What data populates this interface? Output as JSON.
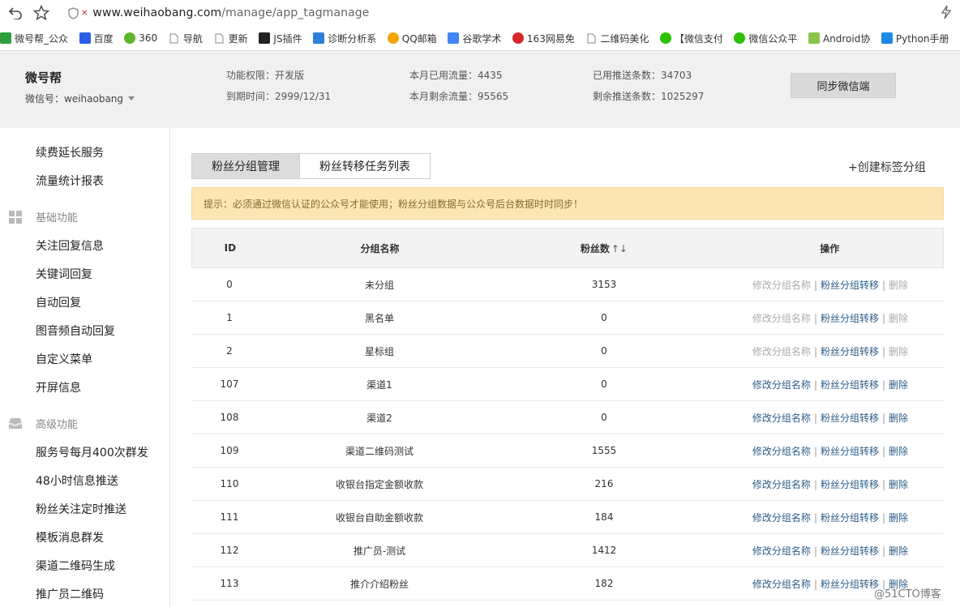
{
  "browser": {
    "url_host": "www.weihaobang.com",
    "url_path": "/manage/app_tagmanage"
  },
  "bookmarks": [
    {
      "label": "微号帮_公众",
      "icon": "weihaobang-icon",
      "color": "#2e9e3e"
    },
    {
      "label": "百度",
      "icon": "baidu-paw-icon",
      "color": "#2b5ce6"
    },
    {
      "label": "360",
      "icon": "360-icon",
      "color": "#5fb52b"
    },
    {
      "label": "导航",
      "icon": "page-icon",
      "color": "#ffffff"
    },
    {
      "label": "更新",
      "icon": "page-icon",
      "color": "#ffffff"
    },
    {
      "label": "JS插件",
      "icon": "js-icon",
      "color": "#222222"
    },
    {
      "label": "诊断分析系",
      "icon": "diagnose-icon",
      "color": "#2f7ed8"
    },
    {
      "label": "QQ邮箱",
      "icon": "qqmail-icon",
      "color": "#f2a400"
    },
    {
      "label": "谷歌学术",
      "icon": "google-icon",
      "color": "#4285f4"
    },
    {
      "label": "163网易免",
      "icon": "netease-icon",
      "color": "#d8272d"
    },
    {
      "label": "二维码美化",
      "icon": "page-icon",
      "color": "#ffffff"
    },
    {
      "label": "【微信支付",
      "icon": "wechat-icon",
      "color": "#2dc100"
    },
    {
      "label": "微信公众平",
      "icon": "wechat-icon",
      "color": "#2dc100"
    },
    {
      "label": "Android协",
      "icon": "android-icon",
      "color": "#8bc34a"
    },
    {
      "label": "Python手册",
      "icon": "python-icon",
      "color": "#1e88e5"
    }
  ],
  "account": {
    "name": "微号帮",
    "wechat_id": "微信号：weihaobang",
    "permission": "功能权限：开发版",
    "expire": "到期时间：2999/12/31",
    "used_traffic": "本月已用流量：4435",
    "remaining_traffic": "本月剩余流量：95565",
    "pushed": "已用推送条数：34703",
    "remaining_push": "剩余推送条数：1025297",
    "sync_button": "同步微信端"
  },
  "sidebar": {
    "top_items": [
      "续费延长服务",
      "流量统计报表"
    ],
    "basic_header": "基础功能",
    "basic_items": [
      "关注回复信息",
      "关键词回复",
      "自动回复",
      "图音频自动回复",
      "自定义菜单",
      "开屏信息"
    ],
    "advanced_header": "高级功能",
    "advanced_items": [
      "服务号每月400次群发",
      "48小时信息推送",
      "粉丝关注定时推送",
      "模板消息群发",
      "渠道二维码生成",
      "推广员二维码"
    ]
  },
  "main": {
    "tabs": [
      "粉丝分组管理",
      "粉丝转移任务列表"
    ],
    "create_link": "+创建标签分组",
    "notice": "提示：必须通过微信认证的公众号才能使用；粉丝分组数据与公众号后台数据时时同步！",
    "columns": {
      "id": "ID",
      "name": "分组名称",
      "fans": "粉丝数",
      "sort": "↑↓",
      "op": "操作"
    },
    "ops": {
      "edit": "修改分组名称",
      "transfer": "粉丝分组转移",
      "delete": "删除",
      "sep": "|"
    },
    "rows": [
      {
        "id": "0",
        "name": "未分组",
        "fans": "3153",
        "editable": false
      },
      {
        "id": "1",
        "name": "黑名单",
        "fans": "0",
        "editable": false
      },
      {
        "id": "2",
        "name": "星标组",
        "fans": "0",
        "editable": false
      },
      {
        "id": "107",
        "name": "渠道1",
        "fans": "0",
        "editable": true
      },
      {
        "id": "108",
        "name": "渠道2",
        "fans": "0",
        "editable": true
      },
      {
        "id": "109",
        "name": "渠道二维码测试",
        "fans": "1555",
        "editable": true
      },
      {
        "id": "110",
        "name": "收银台指定金额收款",
        "fans": "216",
        "editable": true
      },
      {
        "id": "111",
        "name": "收银台自助金额收款",
        "fans": "184",
        "editable": true
      },
      {
        "id": "112",
        "name": "推广员-测试",
        "fans": "1412",
        "editable": true
      },
      {
        "id": "113",
        "name": "推介介绍粉丝",
        "fans": "182",
        "editable": true
      }
    ]
  },
  "watermark": "@51CTO博客"
}
